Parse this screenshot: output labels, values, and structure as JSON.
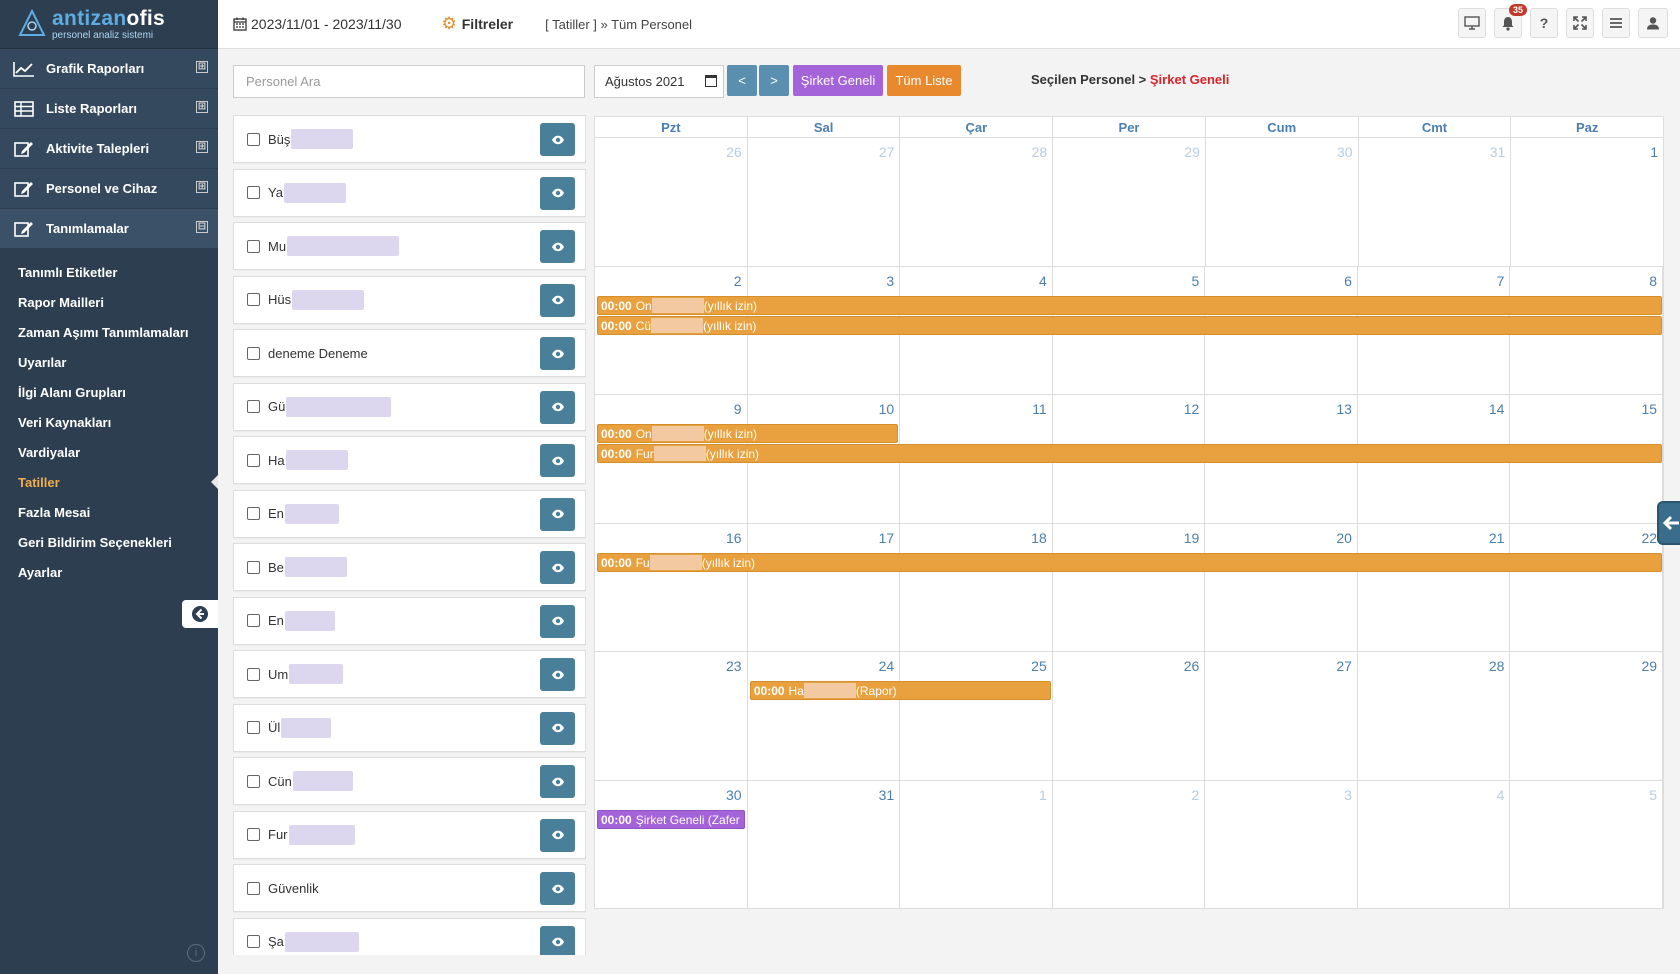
{
  "app": {
    "name_part1": "antizan",
    "name_part2": "ofis",
    "subtitle": "personel analiz sistemi"
  },
  "sidebar": {
    "menu": [
      {
        "label": "Grafik Raporları",
        "toggle": "⊞"
      },
      {
        "label": "Liste Raporları",
        "toggle": "⊞"
      },
      {
        "label": "Aktivite Talepleri",
        "toggle": "⊞"
      },
      {
        "label": "Personel ve Cihaz",
        "toggle": "⊞"
      },
      {
        "label": "Tanımlamalar",
        "toggle": "⊟"
      }
    ],
    "submenu": [
      "Tanımlı Etiketler",
      "Rapor Mailleri",
      "Zaman Aşımı Tanımlamaları",
      "Uyarılar",
      "İlgi Alanı Grupları",
      "Veri Kaynakları",
      "Vardiyalar",
      "Tatiller",
      "Fazla Mesai",
      "Geri Bildirim Seçenekleri",
      "Ayarlar"
    ],
    "active_sub": "Tatiller"
  },
  "topbar": {
    "date_range": "2023/11/01 - 2023/11/30",
    "filters_label": "Filtreler",
    "breadcrumb": "[ Tatiller ] » Tüm Personel",
    "notification_count": "35",
    "help_label": "?"
  },
  "people": {
    "search_placeholder": "Personel Ara",
    "list": [
      {
        "prefix": "Büş"
      },
      {
        "prefix": "Ya"
      },
      {
        "prefix": "Mu"
      },
      {
        "prefix": "Hüs"
      },
      {
        "prefix": "deneme Deneme"
      },
      {
        "prefix": "Gü"
      },
      {
        "prefix": "Ha"
      },
      {
        "prefix": "En"
      },
      {
        "prefix": "Be"
      },
      {
        "prefix": "En"
      },
      {
        "prefix": "Um"
      },
      {
        "prefix": "Ül"
      },
      {
        "prefix": "Cün"
      },
      {
        "prefix": "Fur"
      },
      {
        "prefix": "Güvenlik"
      },
      {
        "prefix": "Şa"
      }
    ]
  },
  "calendar": {
    "month_value": "Ağustos 2021",
    "prev_label": "<",
    "next_label": ">",
    "company_button": "Şirket Geneli",
    "all_list_button": "Tüm Liste",
    "selected_prefix": "Seçilen Personel >",
    "selected_value": "Şirket Geneli",
    "weekdays": [
      "Pzt",
      "Sal",
      "Çar",
      "Per",
      "Cum",
      "Cmt",
      "Paz"
    ],
    "weeks": [
      [
        "26",
        "27",
        "28",
        "29",
        "30",
        "31",
        "1"
      ],
      [
        "2",
        "3",
        "4",
        "5",
        "6",
        "7",
        "8"
      ],
      [
        "9",
        "10",
        "11",
        "12",
        "13",
        "14",
        "15"
      ],
      [
        "16",
        "17",
        "18",
        "19",
        "20",
        "21",
        "22"
      ],
      [
        "23",
        "24",
        "25",
        "26",
        "27",
        "28",
        "29"
      ],
      [
        "30",
        "31",
        "1",
        "2",
        "3",
        "4",
        "5"
      ]
    ],
    "events": [
      {
        "time": "00:00",
        "prefix": "On",
        "type": "(yıllık izin)"
      },
      {
        "time": "00:00",
        "prefix": "Cü",
        "type": "(yıllık izin)"
      },
      {
        "time": "00:00",
        "prefix": "On",
        "type": "(yıllık izin)"
      },
      {
        "time": "00:00",
        "prefix": "Fur",
        "type": "(yıllık izin)"
      },
      {
        "time": "00:00",
        "prefix": "Fu",
        "type": "(yıllık izin)"
      },
      {
        "time": "00:00",
        "prefix": "Ha",
        "type": "(Rapor)"
      },
      {
        "time": "00:00",
        "prefix": "Şirket Geneli (Zafer",
        "type": ""
      }
    ]
  },
  "colors": {
    "sidebar_bg": "#2c3e50",
    "accent_orange": "#e8a13e",
    "accent_purple": "#a463d8",
    "nav_blue": "#5b8fb0",
    "eye_button": "#4a7f99",
    "active_menu": "#f0ad4e",
    "selected_red": "#d9242a"
  }
}
